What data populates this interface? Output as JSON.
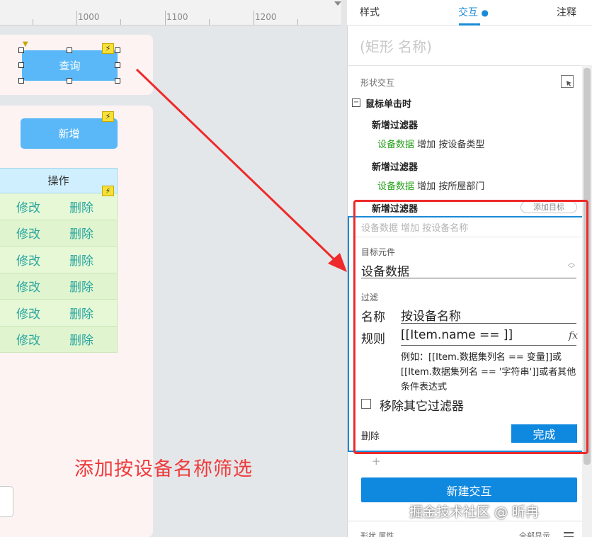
{
  "ruler": {
    "labels": [
      "1000",
      "1100",
      "1200"
    ]
  },
  "canvas": {
    "query_button": "查询",
    "add_button": "新增",
    "table": {
      "header": "操作",
      "rows": [
        {
          "edit": "修改",
          "delete": "删除"
        },
        {
          "edit": "修改",
          "delete": "删除"
        },
        {
          "edit": "修改",
          "delete": "删除"
        },
        {
          "edit": "修改",
          "delete": "删除"
        },
        {
          "edit": "修改",
          "delete": "删除"
        },
        {
          "edit": "修改",
          "delete": "删除"
        }
      ]
    },
    "bolt_glyph": "⚡",
    "annotation": "添加按设备名称筛选"
  },
  "inspector": {
    "tabs": {
      "style": "样式",
      "interaction": "交互",
      "interaction_dot": "●",
      "notes": "注释"
    },
    "shape_name_placeholder": "(矩形 名称)",
    "section_label": "形状交互",
    "event": {
      "collapse_glyph": "−",
      "label": "鼠标单击时"
    },
    "actions": [
      {
        "title": "新增过滤器",
        "target": "设备数据",
        "verb": "增加",
        "filter": "按设备类型"
      },
      {
        "title": "新增过滤器",
        "target": "设备数据",
        "verb": "增加",
        "filter": "按所屋部门"
      },
      {
        "title": "新增过滤器"
      }
    ],
    "add_target": "添加目标",
    "editor": {
      "summary_placeholder": "设备数据 增加 按设备名称",
      "target_label": "目标元件",
      "target_value": "设备数据",
      "filter_label": "过滤",
      "name_label": "名称",
      "name_value": "按设备名称",
      "rule_label": "规则",
      "rule_value": "[[Item.name == ]]",
      "fx": "fx",
      "example_text": "例如：[[Item.数据集列名 == 变量]]或[[Item.数据集列名 == '字符串']]或者其他条件表达式",
      "remove_others_label": "移除其它过滤器",
      "delete": "删除",
      "done": "完成"
    },
    "plus": "+",
    "new_interaction": "新建交互",
    "bottom_left": "形状 属性",
    "bottom_right": "全部显示"
  },
  "watermark": "掘金技术社区 @ 昕冉",
  "colors": {
    "accent_blue": "#1a8ad6",
    "button_blue": "#0f88df",
    "shape_blue": "#5bb8f8",
    "annotation_red": "#ee2a2a",
    "action_green": "#27a11c"
  }
}
